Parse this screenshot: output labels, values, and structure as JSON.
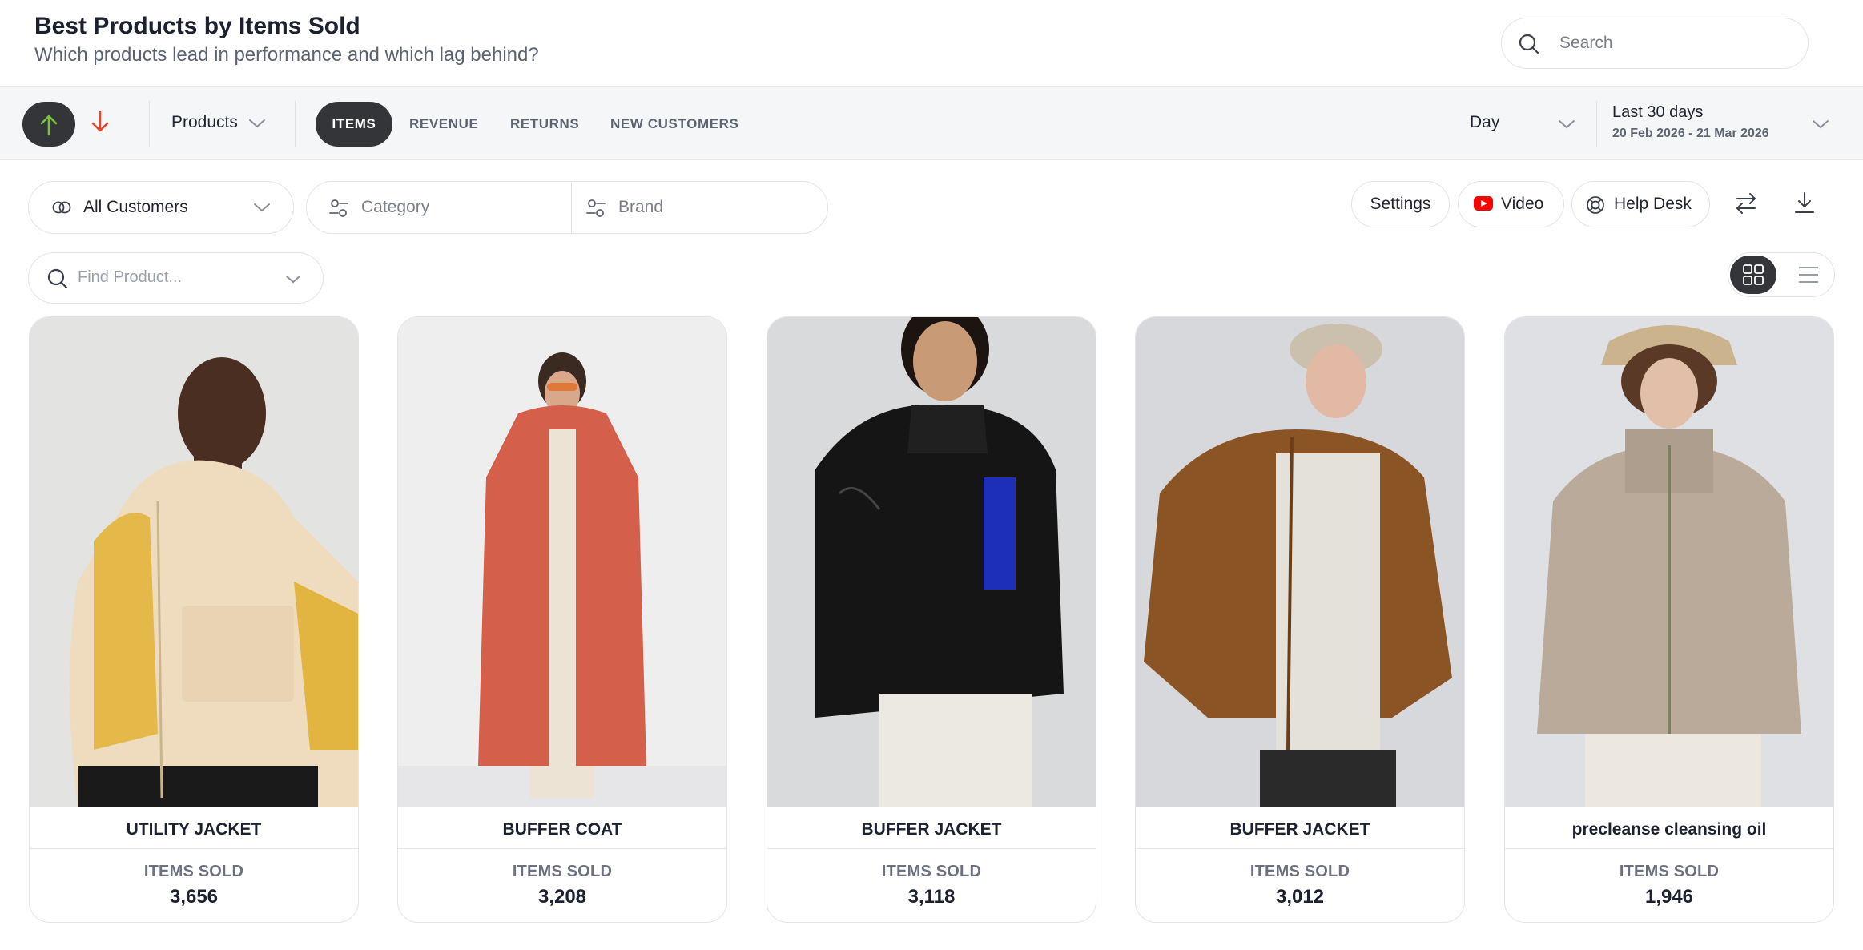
{
  "header": {
    "title": "Best Products by Items Sold",
    "subtitle": "Which products lead in performance and which lag behind?",
    "search_placeholder": "Search"
  },
  "toolbar": {
    "sort_up_icon": "arrow-up-icon",
    "sort_down_icon": "arrow-down-icon",
    "sort_up_color": "#7cc242",
    "sort_down_color": "#e2462e",
    "dimension": "Products",
    "tabs": [
      {
        "label": "ITEMS",
        "active": true
      },
      {
        "label": "REVENUE",
        "active": false
      },
      {
        "label": "RETURNS",
        "active": false
      },
      {
        "label": "NEW CUSTOMERS",
        "active": false
      }
    ],
    "granularity": "Day",
    "date_range": {
      "label": "Last 30 days",
      "dates": "20 Feb 2026 - 21 Mar 2026"
    }
  },
  "filters": {
    "customers": "All Customers",
    "category_placeholder": "Category",
    "brand_placeholder": "Brand",
    "find_product_placeholder": "Find Product...",
    "settings_label": "Settings",
    "video_label": "Video",
    "helpdesk_label": "Help Desk",
    "video_icon_color": "#ff0000",
    "view_mode": "grid"
  },
  "products": [
    {
      "name": "UTILITY JACKET",
      "metric_label": "ITEMS SOLD",
      "value": "3,656",
      "image": "man in cream utility jacket with yellow sleeves"
    },
    {
      "name": "BUFFER COAT",
      "metric_label": "ITEMS SOLD",
      "value": "3,208",
      "image": "woman in long red puffer coat"
    },
    {
      "name": "BUFFER JACKET",
      "metric_label": "ITEMS SOLD",
      "value": "3,118",
      "image": "woman in black glossy puffer jacket"
    },
    {
      "name": "BUFFER JACKET",
      "metric_label": "ITEMS SOLD",
      "value": "3,012",
      "image": "man in brown glossy puffer jacket with cap"
    },
    {
      "name": "precleanse cleansing oil",
      "metric_label": "ITEMS SOLD",
      "value": "1,946",
      "image": "man in beige puffer jacket with bucket hat"
    }
  ]
}
